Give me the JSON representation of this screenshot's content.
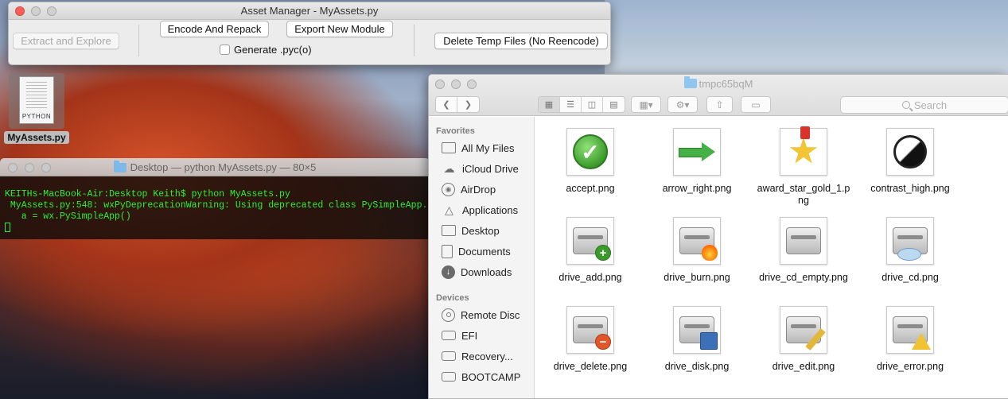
{
  "asset_manager": {
    "title": "Asset Manager - MyAssets.py",
    "buttons": {
      "extract": "Extract and Explore",
      "encode": "Encode And Repack",
      "export": "Export New Module",
      "delete_temp": "Delete Temp Files (No Reencode)"
    },
    "checkbox_label": "Generate .pyc(o)"
  },
  "desktop_file": {
    "badge": "PYTHON",
    "name": "MyAssets.py"
  },
  "terminal": {
    "title": "Desktop — python MyAssets.py — 80×5",
    "lines": [
      "KEITHs-MacBook-Air:Desktop Keith$ python MyAssets.py",
      " MyAssets.py:548: wxPyDeprecationWarning: Using deprecated class PySimpleApp.",
      "   a = wx.PySimpleApp()"
    ]
  },
  "finder": {
    "title": "tmpc65bqM",
    "search_placeholder": "Search",
    "sidebar": {
      "favorites_header": "Favorites",
      "favorites": [
        {
          "label": "All My Files",
          "icon": "all-files-icon"
        },
        {
          "label": "iCloud Drive",
          "icon": "cloud-icon"
        },
        {
          "label": "AirDrop",
          "icon": "airdrop-icon"
        },
        {
          "label": "Applications",
          "icon": "applications-icon"
        },
        {
          "label": "Desktop",
          "icon": "desktop-icon"
        },
        {
          "label": "Documents",
          "icon": "documents-icon"
        },
        {
          "label": "Downloads",
          "icon": "downloads-icon"
        }
      ],
      "devices_header": "Devices",
      "devices": [
        {
          "label": "Remote Disc",
          "icon": "disc-icon"
        },
        {
          "label": "EFI",
          "icon": "drive-icon"
        },
        {
          "label": "Recovery...",
          "icon": "drive-icon"
        },
        {
          "label": "BOOTCAMP",
          "icon": "drive-icon"
        }
      ]
    },
    "files": [
      {
        "name": "accept.png",
        "icon": "accept"
      },
      {
        "name": "arrow_right.png",
        "icon": "arrow"
      },
      {
        "name": "award_star_gold_1.png",
        "icon": "star"
      },
      {
        "name": "contrast_high.png",
        "icon": "contrast"
      },
      {
        "name": "drive_add.png",
        "icon": "drive-add"
      },
      {
        "name": "drive_burn.png",
        "icon": "drive-burn"
      },
      {
        "name": "drive_cd_empty.png",
        "icon": "drive-cd-empty"
      },
      {
        "name": "drive_cd.png",
        "icon": "drive-cd"
      },
      {
        "name": "drive_delete.png",
        "icon": "drive-delete"
      },
      {
        "name": "drive_disk.png",
        "icon": "drive-disk"
      },
      {
        "name": "drive_edit.png",
        "icon": "drive-edit"
      },
      {
        "name": "drive_error.png",
        "icon": "drive-error"
      }
    ]
  }
}
